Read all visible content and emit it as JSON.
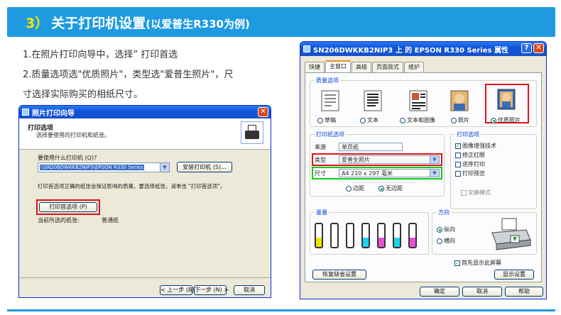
{
  "header": {
    "number": "3）",
    "title": "关于打印机设置",
    "subtitle": "(以爱普生R330为例)"
  },
  "instructions": {
    "line1": "1.在照片打印向导中，选择” 打印首选",
    "line2": "2.质量选项选\"优质照片\"，类型选\"爱普生照片\"，尺",
    "line3": "寸选择实际购买的相纸尺寸。"
  },
  "wizard": {
    "title": "照片打印向导",
    "heading": "打印选项",
    "subheading": "选择要使用的打印机和纸张。",
    "printer_question": "要使用什么打印机 (Q)?",
    "printer_value": "\\\\SN206DWKKB2NIP3\\EPSON R330 Series",
    "install_button": "安装打印机 (S)...",
    "note": "打印首选项正确的纸张会保证影响的质量。要选择纸张，请单击 \"打印首选项\"。",
    "preferences_button": "打印首选项 (P)",
    "selected_paper_label": "当前所选的纸张:",
    "selected_paper_value": "普通纸",
    "back_button": "< 上一步 (B)",
    "next_button": "下一步 (N) >",
    "cancel_button": "取消"
  },
  "props": {
    "title": "SN206DWKKB2NIP3 上 的 EPSON R330 Series 属性",
    "tabs": [
      "快捷",
      "主窗口",
      "高级",
      "页面版式",
      "维护"
    ],
    "quality": {
      "title": "质量选项",
      "options": [
        "草稿",
        "文本",
        "文本和图像",
        "照片",
        "优质照片"
      ],
      "selected": "优质照片"
    },
    "paper": {
      "title": "打印纸选项",
      "source_label": "来源",
      "source_value": "单页纸",
      "type_label": "类型",
      "type_value": "爱普生照片",
      "size_label": "尺寸",
      "size_value": "A4 210 x 297 毫米",
      "margin_options": [
        "边距",
        "无边距"
      ],
      "margin_selected": "无边距"
    },
    "print_options": {
      "title": "打印选项",
      "items": [
        {
          "label": "图像增强技术",
          "checked": true
        },
        {
          "label": "修正红眼",
          "checked": false
        },
        {
          "label": "逆序打印",
          "checked": false
        },
        {
          "label": "打印预览",
          "checked": false
        }
      ],
      "quiet_mode": "安静模式"
    },
    "ink": {
      "title": "墨量",
      "levels": [
        {
          "color": "#f1e600",
          "level": 0.4
        },
        {
          "color": "#111111",
          "level": 0.0
        },
        {
          "color": "#111111",
          "level": 0.0
        },
        {
          "color": "#19d5e8",
          "level": 0.4
        },
        {
          "color": "#e850d8",
          "level": 0.4
        },
        {
          "color": "#19d5e8",
          "level": 0.4
        },
        {
          "color": "#e850d8",
          "level": 0.4
        }
      ]
    },
    "orientation": {
      "title": "方向",
      "options": [
        "纵向",
        "横向"
      ],
      "selected": "纵向"
    },
    "show_settings_check": "首先显示此屏幕",
    "restore_button": "恢复缺省设置",
    "show_settings_button": "显示设置",
    "ok_button": "确定",
    "cancel_button": "取消",
    "help_button": "帮助"
  },
  "colors": {
    "banner": "#1e9be0",
    "number_accent": "#ffe100",
    "highlight_red": "#e0121a",
    "highlight_green": "#13c91a"
  }
}
